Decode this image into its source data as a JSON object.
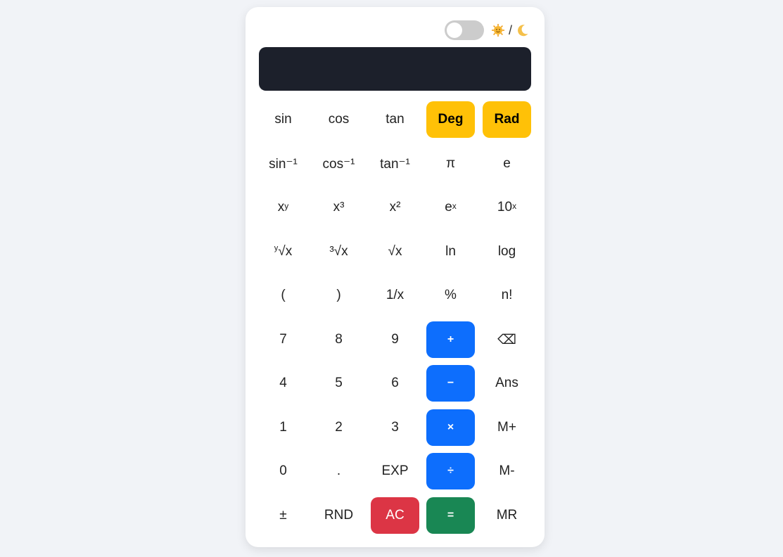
{
  "theme": {
    "toggle_state": "light",
    "separator": "/",
    "light_icon": "sun-emoji-icon",
    "dark_icon": "moon-emoji-icon"
  },
  "display": {
    "value": ""
  },
  "colors": {
    "mode": "#ffc107",
    "operator": "#0d6efd",
    "clear": "#dc3545",
    "equals": "#198754",
    "display_bg": "#1c202b"
  },
  "keys": {
    "sin": "sin",
    "cos": "cos",
    "tan": "tan",
    "deg": "Deg",
    "rad": "Rad",
    "asin": "sin⁻¹",
    "acos": "cos⁻¹",
    "atan": "tan⁻¹",
    "pi": "π",
    "e": "e",
    "pow_base": "x",
    "pow_exp": "y",
    "cube": "x³",
    "square": "x²",
    "exp_base": "e",
    "exp_exp": "x",
    "ten_base": "10",
    "ten_exp": "x",
    "yroot_pre": "y",
    "yroot_main": "√x",
    "cbrt": "³√x",
    "sqrt": "√x",
    "ln": "ln",
    "log": "log",
    "lparen": "(",
    "rparen": ")",
    "recip": "1/x",
    "percent": "%",
    "fact": "n!",
    "seven": "7",
    "eight": "8",
    "nine": "9",
    "plus": "+",
    "backspace": "⌫",
    "four": "4",
    "five": "5",
    "six": "6",
    "minus": "−",
    "ans": "Ans",
    "one": "1",
    "two": "2",
    "three": "3",
    "times": "×",
    "mplus": "M+",
    "zero": "0",
    "dot": ".",
    "expkey": "EXP",
    "divide": "÷",
    "mminus": "M-",
    "plusminus": "±",
    "rnd": "RND",
    "ac": "AC",
    "equals": "=",
    "mr": "MR"
  }
}
